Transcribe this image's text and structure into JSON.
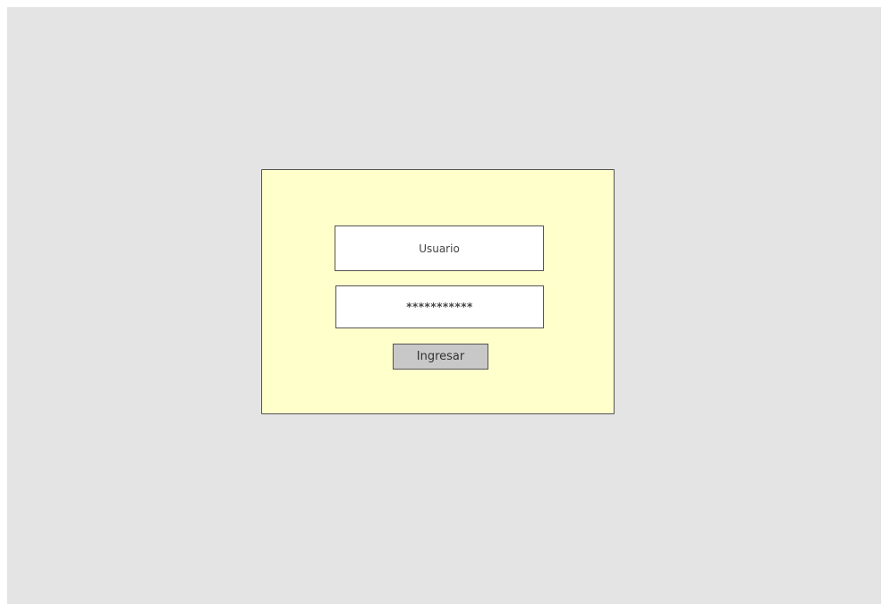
{
  "login": {
    "username_placeholder": "Usuario",
    "password_value": "***********",
    "submit_label": "Ingresar"
  },
  "colors": {
    "background": "#e4e4e4",
    "panel": "#ffffcc",
    "input": "#ffffff",
    "button": "#c8c8c8",
    "border": "#555555"
  }
}
